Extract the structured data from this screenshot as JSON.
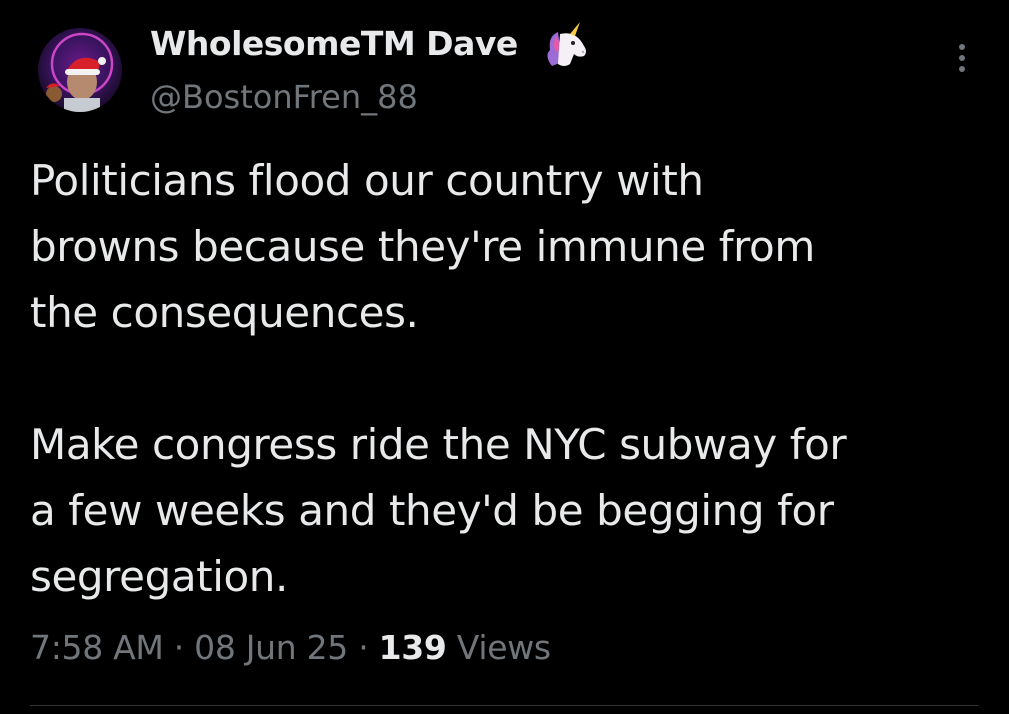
{
  "author": {
    "display_name": "WholesomeTM Dave",
    "handle": "@BostonFren_88",
    "name_emoji": "unicorn-icon",
    "avatar": "avatar"
  },
  "tweet": {
    "paragraph_1": [
      "Politicians flood our country with",
      "browns because they're immune from",
      "the consequences."
    ],
    "paragraph_2": [
      "Make congress ride the NYC subway for",
      "a few weeks and they'd be begging for",
      "segregation."
    ]
  },
  "meta": {
    "time": "7:58 AM",
    "separator": "·",
    "date": "08 Jun 25",
    "views_count": "139",
    "views_label": "Views"
  },
  "colors": {
    "background": "#000000",
    "primary_text": "#e7e9ea",
    "secondary_text": "#71767b",
    "divider": "#2f3336"
  }
}
